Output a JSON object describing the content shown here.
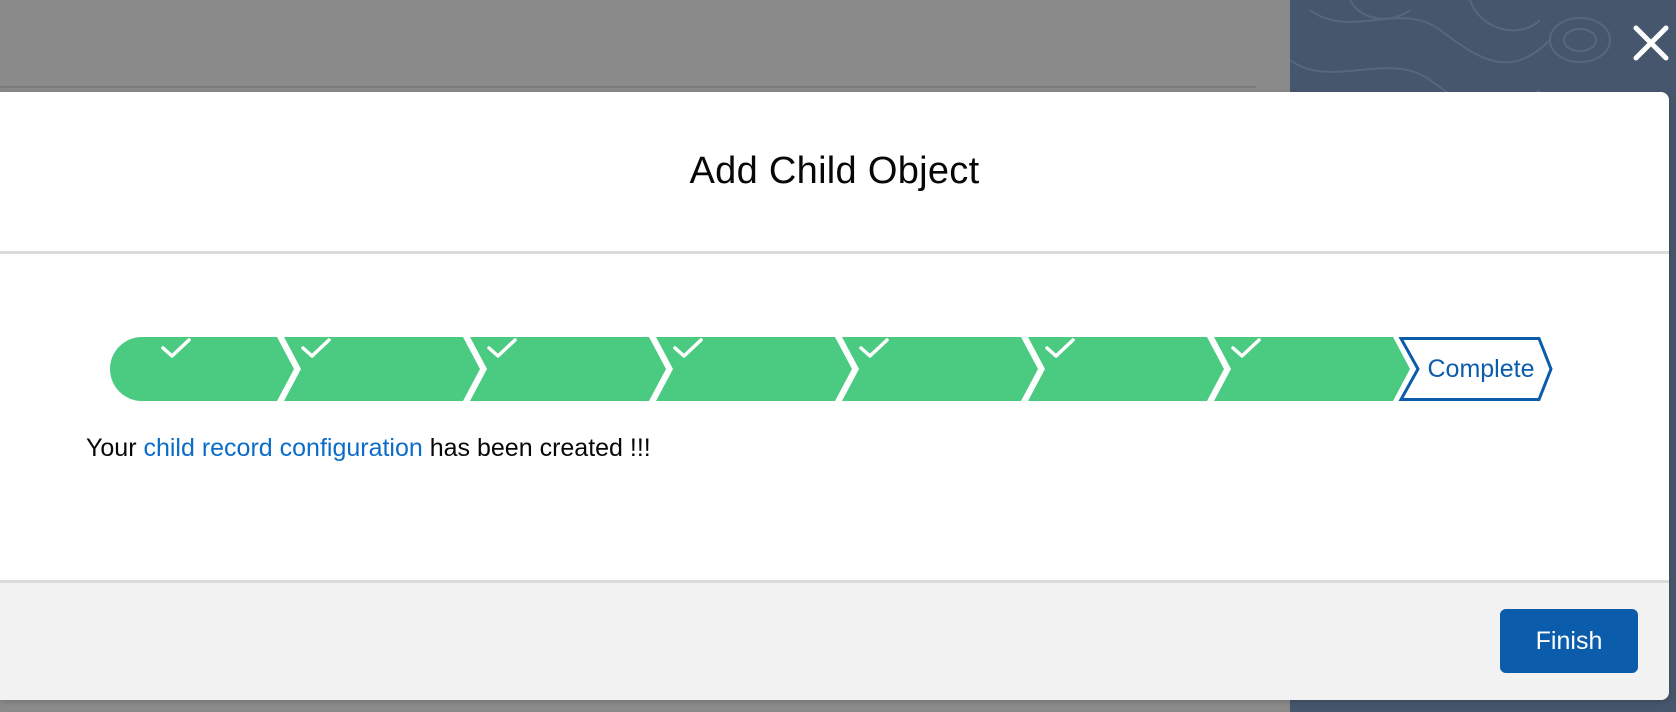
{
  "modal": {
    "title": "Add Child Object",
    "close_label": "×"
  },
  "path": {
    "completed_steps": 7,
    "current_step_label": "Complete"
  },
  "message": {
    "prefix": "Your",
    "link_text": "child record configuration",
    "suffix": "has been created !!!"
  },
  "footer": {
    "finish_label": "Finish"
  },
  "colors": {
    "step_complete": "#4bca81",
    "step_current_border": "#0b5cab",
    "brand": "#0b5cab",
    "link": "#0b6dc9"
  }
}
